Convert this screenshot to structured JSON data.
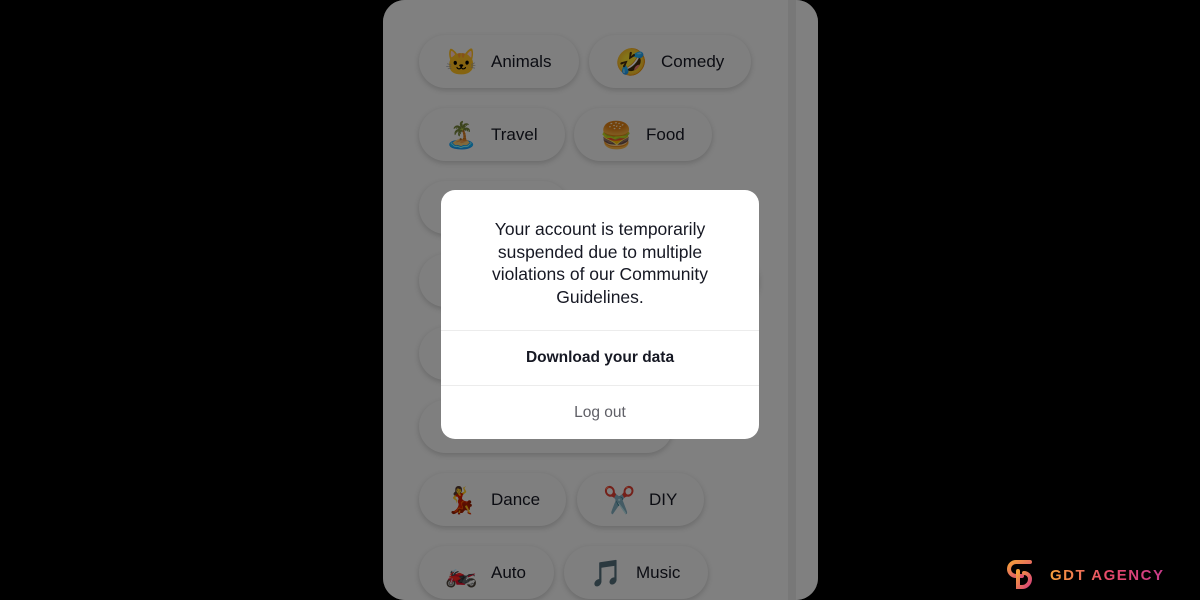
{
  "categories": [
    {
      "label": "Animals",
      "icon": "🐱",
      "icon_name": "cat-face-icon"
    },
    {
      "label": "Comedy",
      "icon": "🤣",
      "icon_name": "laughing-face-icon"
    },
    {
      "label": "Travel",
      "icon": "🏝️",
      "icon_name": "beach-umbrella-icon"
    },
    {
      "label": "Food",
      "icon": "🍔",
      "icon_name": "burger-icon"
    },
    {
      "label": "Dance",
      "icon": "💃",
      "icon_name": "dancer-icon"
    },
    {
      "label": "DIY",
      "icon": "✂️",
      "icon_name": "scissors-icon"
    },
    {
      "label": "Auto",
      "icon": "🏍️",
      "icon_name": "motorcycle-icon"
    },
    {
      "label": "Music",
      "icon": "🎵",
      "icon_name": "music-note-icon"
    }
  ],
  "modal": {
    "message": "Your account is temporarily suspended due to multiple violations of our Community Guidelines.",
    "primary_button": "Download your data",
    "secondary_button": "Log out"
  },
  "watermark": {
    "brand": "GDT AGENCY",
    "colors": {
      "start": "#f5a13a",
      "end": "#c73a8a"
    }
  }
}
